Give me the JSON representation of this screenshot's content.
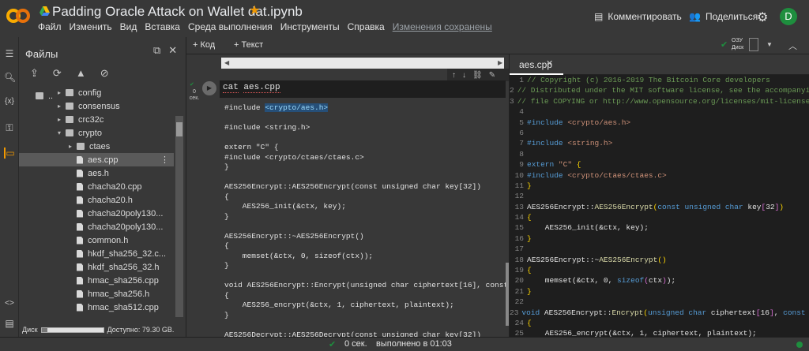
{
  "window": {
    "notebook_title": "Padding Oracle Attack on Wallet dat.ipynb"
  },
  "menu": [
    "Файл",
    "Изменить",
    "Вид",
    "Вставка",
    "Среда выполнения",
    "Инструменты",
    "Справка"
  ],
  "saved_status": "Изменения сохранены",
  "header": {
    "comment_label": "Комментировать",
    "share_label": "Поделиться",
    "avatar_letter": "D"
  },
  "files_panel": {
    "title": "Файлы",
    "parent_dir": "..",
    "tree": [
      {
        "label": "config",
        "type": "folder",
        "depth": 1,
        "arrow": "▸"
      },
      {
        "label": "consensus",
        "type": "folder",
        "depth": 1,
        "arrow": "▸"
      },
      {
        "label": "crc32c",
        "type": "folder",
        "depth": 1,
        "arrow": "▸"
      },
      {
        "label": "crypto",
        "type": "folder",
        "depth": 1,
        "arrow": "▾"
      },
      {
        "label": "ctaes",
        "type": "folder",
        "depth": 2,
        "arrow": "▸"
      },
      {
        "label": "aes.cpp",
        "type": "file",
        "depth": 2,
        "arrow": "",
        "selected": true
      },
      {
        "label": "aes.h",
        "type": "file",
        "depth": 2,
        "arrow": ""
      },
      {
        "label": "chacha20.cpp",
        "type": "file",
        "depth": 2,
        "arrow": ""
      },
      {
        "label": "chacha20.h",
        "type": "file",
        "depth": 2,
        "arrow": ""
      },
      {
        "label": "chacha20poly130...",
        "type": "file",
        "depth": 2,
        "arrow": ""
      },
      {
        "label": "chacha20poly130...",
        "type": "file",
        "depth": 2,
        "arrow": ""
      },
      {
        "label": "common.h",
        "type": "file",
        "depth": 2,
        "arrow": ""
      },
      {
        "label": "hkdf_sha256_32.c...",
        "type": "file",
        "depth": 2,
        "arrow": ""
      },
      {
        "label": "hkdf_sha256_32.h",
        "type": "file",
        "depth": 2,
        "arrow": ""
      },
      {
        "label": "hmac_sha256.cpp",
        "type": "file",
        "depth": 2,
        "arrow": ""
      },
      {
        "label": "hmac_sha256.h",
        "type": "file",
        "depth": 2,
        "arrow": ""
      },
      {
        "label": "hmac_sha512.cpp",
        "type": "file",
        "depth": 2,
        "arrow": ""
      }
    ],
    "disk_label": "Диск",
    "disk_available": "Доступно: 79.30 GB.",
    "disk_used_fraction": 0.1
  },
  "toolbar": {
    "add_code": "+ Код",
    "add_text": "+ Текст",
    "ram_label": "ОЗУ",
    "disk_label": "Диск"
  },
  "cell": {
    "exec_count": "0",
    "exec_unit": "сек.",
    "command_cmd": "cat",
    "command_arg": "aes.cpp"
  },
  "output_lines": [
    "#include <crypto/aes.h>",
    "",
    "#include <string.h>",
    "",
    "extern \"C\" {",
    "#include <crypto/ctaes/ctaes.c>",
    "}",
    "",
    "AES256Encrypt::AES256Encrypt(const unsigned char key[32])",
    "{",
    "    AES256_init(&ctx, key);",
    "}",
    "",
    "AES256Encrypt::~AES256Encrypt()",
    "{",
    "    memset(&ctx, 0, sizeof(ctx));",
    "}",
    "",
    "void AES256Encrypt::Encrypt(unsigned char ciphertext[16], const un",
    "{",
    "    AES256_encrypt(&ctx, 1, ciphertext, plaintext);",
    "}",
    "",
    "AES256Decrypt::AES256Decrypt(const unsigned char key[32])"
  ],
  "output_highlight": "<crypto/aes.h>",
  "editor": {
    "tab_label": "aes.cpp",
    "lines": [
      {
        "n": "1",
        "segs": [
          [
            "c-com",
            "// Copyright (c) 2016-2019 The Bitcoin Core developers"
          ]
        ]
      },
      {
        "n": "2",
        "segs": [
          [
            "c-com",
            "// Distributed under the MIT software license, see the accompanying"
          ]
        ]
      },
      {
        "n": "3",
        "segs": [
          [
            "c-com",
            "// file COPYING or http://www.opensource.org/licenses/mit-license.php"
          ]
        ]
      },
      {
        "n": "4",
        "segs": []
      },
      {
        "n": "5",
        "segs": [
          [
            "c-kw",
            "#include"
          ],
          [
            "tx",
            " "
          ],
          [
            "c-str",
            "<crypto/aes.h>"
          ]
        ]
      },
      {
        "n": "6",
        "segs": []
      },
      {
        "n": "7",
        "segs": [
          [
            "c-kw",
            "#include"
          ],
          [
            "tx",
            " "
          ],
          [
            "c-str",
            "<string.h>"
          ]
        ]
      },
      {
        "n": "8",
        "segs": []
      },
      {
        "n": "9",
        "segs": [
          [
            "c-kw",
            "extern"
          ],
          [
            "tx",
            " "
          ],
          [
            "c-str",
            "\"C\""
          ],
          [
            "tx",
            " "
          ],
          [
            "c-y",
            "{"
          ]
        ]
      },
      {
        "n": "10",
        "segs": [
          [
            "c-kw",
            "#include"
          ],
          [
            "tx",
            " "
          ],
          [
            "c-str",
            "<crypto/ctaes/ctaes.c>"
          ]
        ]
      },
      {
        "n": "11",
        "segs": [
          [
            "c-y",
            "}"
          ]
        ]
      },
      {
        "n": "12",
        "segs": []
      },
      {
        "n": "13",
        "segs": [
          [
            "tx",
            "AES256Encrypt::"
          ],
          [
            "c-fn",
            "AES256Encrypt"
          ],
          [
            "c-y",
            "("
          ],
          [
            "c-kw",
            "const unsigned char"
          ],
          [
            "tx",
            " key"
          ],
          [
            "c-p",
            "["
          ],
          [
            "tx",
            "32"
          ],
          [
            "c-p",
            "]"
          ],
          [
            "c-y",
            ")"
          ]
        ]
      },
      {
        "n": "14",
        "segs": [
          [
            "c-y",
            "{"
          ]
        ]
      },
      {
        "n": "15",
        "segs": [
          [
            "tx",
            "    AES256_init(&ctx, key);"
          ]
        ]
      },
      {
        "n": "16",
        "segs": [
          [
            "c-y",
            "}"
          ]
        ]
      },
      {
        "n": "17",
        "segs": []
      },
      {
        "n": "18",
        "segs": [
          [
            "tx",
            "AES256Encrypt::~"
          ],
          [
            "c-fn",
            "AES256Encrypt"
          ],
          [
            "c-y",
            "()"
          ]
        ]
      },
      {
        "n": "19",
        "segs": [
          [
            "c-y",
            "{"
          ]
        ]
      },
      {
        "n": "20",
        "segs": [
          [
            "tx",
            "    memset(&ctx, 0, "
          ],
          [
            "c-kw",
            "sizeof"
          ],
          [
            "c-p",
            "("
          ],
          [
            "tx",
            "ctx"
          ],
          [
            "c-p",
            ")"
          ],
          [
            "tx",
            ");"
          ]
        ]
      },
      {
        "n": "21",
        "segs": [
          [
            "c-y",
            "}"
          ]
        ]
      },
      {
        "n": "22",
        "segs": []
      },
      {
        "n": "23",
        "segs": [
          [
            "c-kw",
            "void"
          ],
          [
            "tx",
            " AES256Encrypt::"
          ],
          [
            "c-fn",
            "Encrypt"
          ],
          [
            "c-y",
            "("
          ],
          [
            "c-kw",
            "unsigned char"
          ],
          [
            "tx",
            " ciphertext"
          ],
          [
            "c-p",
            "["
          ],
          [
            "tx",
            "16"
          ],
          [
            "c-p",
            "]"
          ],
          [
            "tx",
            ", "
          ],
          [
            "c-kw",
            "const"
          ],
          [
            "tx",
            " uns"
          ]
        ]
      },
      {
        "n": "24",
        "segs": [
          [
            "c-y",
            "{"
          ]
        ]
      },
      {
        "n": "25",
        "segs": [
          [
            "tx",
            "    AES256_encrypt(&ctx, 1, ciphertext, plaintext);"
          ]
        ]
      }
    ]
  },
  "status": {
    "time": "0 сек.",
    "done": "выполнено в 01:03"
  },
  "colors": {
    "accent_green": "#1e8e3e",
    "star": "#f29900",
    "selection": "#264f78",
    "background": "#383838"
  }
}
